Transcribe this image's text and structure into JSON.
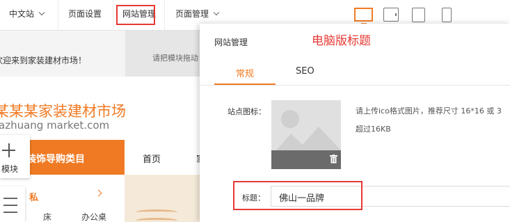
{
  "toolbar": {
    "site_language": "中文站",
    "page_settings": "页面设置",
    "site_management": "网站管理",
    "page_management": "页面管理",
    "devices": [
      "desktop-icon",
      "tablet-landscape-icon",
      "tablet-icon",
      "phone-icon"
    ]
  },
  "preview": {
    "welcome": "欢迎来到家装建材市场！",
    "drag_hint": "请把模块拖动",
    "site_name": "某某某家装建材市场",
    "site_url": "azhuang market.com",
    "category_header": "装饰导购类目",
    "nav": [
      "首页",
      "家"
    ],
    "category_item": "私",
    "category_subs": [
      "床",
      "办公桌"
    ],
    "add_module_label": "模块"
  },
  "panel": {
    "title": "网站管理",
    "annotation": "电脑版标题",
    "tabs": [
      "常规",
      "SEO"
    ],
    "favicon_label": "站点图标：",
    "favicon_hint_line1": "请上传ico格式图片，推荐尺寸 16*16 或 3",
    "favicon_hint_line2": "超过16KB",
    "title_label": "标题：",
    "title_value": "佛山一品牌"
  },
  "colors": {
    "accent": "#f07a23",
    "annotation_red": "#e53935"
  }
}
